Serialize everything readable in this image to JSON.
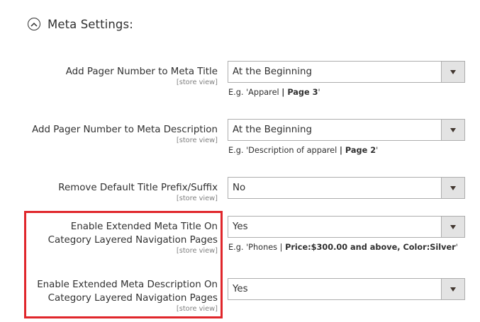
{
  "section": {
    "title": "Meta Settings:",
    "icon": "chevron-up-icon"
  },
  "rows": [
    {
      "label_lines": [
        "Add Pager Number to Meta Title"
      ],
      "scope": "[store view]",
      "value": "At the Beginning",
      "note_prefix": "E.g. 'Apparel ",
      "note_bold": "| Page 3",
      "note_suffix": "'"
    },
    {
      "label_lines": [
        "Add Pager Number to Meta Description"
      ],
      "scope": "[store view]",
      "value": "At the Beginning",
      "note_prefix": "E.g. 'Description of apparel ",
      "note_bold": "| Page 2",
      "note_suffix": "'"
    },
    {
      "label_lines": [
        "Remove Default Title Prefix/Suffix"
      ],
      "scope": "[store view]",
      "value": "No"
    },
    {
      "label_lines": [
        "Enable Extended Meta Title On",
        "Category Layered Navigation Pages"
      ],
      "scope": "[store view]",
      "value": "Yes",
      "note_prefix": "E.g. 'Phones | ",
      "note_bold": "Price:$300.00 and above, Color:Silver",
      "note_suffix": "'"
    },
    {
      "label_lines": [
        "Enable Extended Meta Description On",
        "Category Layered Navigation Pages"
      ],
      "scope": "[store view]",
      "value": "Yes"
    }
  ],
  "colors": {
    "highlight": "#e0262b",
    "arrow_bg": "#e3e3e3",
    "border": "#adadad"
  }
}
